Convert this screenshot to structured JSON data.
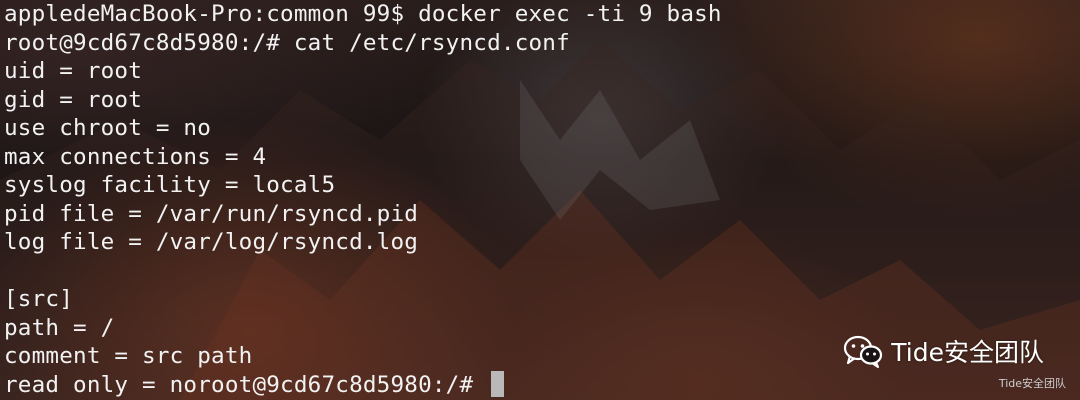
{
  "terminal": {
    "lines": [
      "appledeMacBook-Pro:common 99$ docker exec -ti 9 bash",
      "root@9cd67c8d5980:/# cat /etc/rsyncd.conf",
      "uid = root",
      "gid = root",
      "use chroot = no",
      "max connections = 4",
      "syslog facility = local5",
      "pid file = /var/run/rsyncd.pid",
      "log file = /var/log/rsyncd.log",
      "",
      "[src]",
      "path = /",
      "comment = src path",
      "read only = noroot@9cd67c8d5980:/# "
    ]
  },
  "watermark": {
    "label": "Tide安全团队",
    "small_label": "Tide安全团队",
    "icon": "wechat-icon"
  }
}
